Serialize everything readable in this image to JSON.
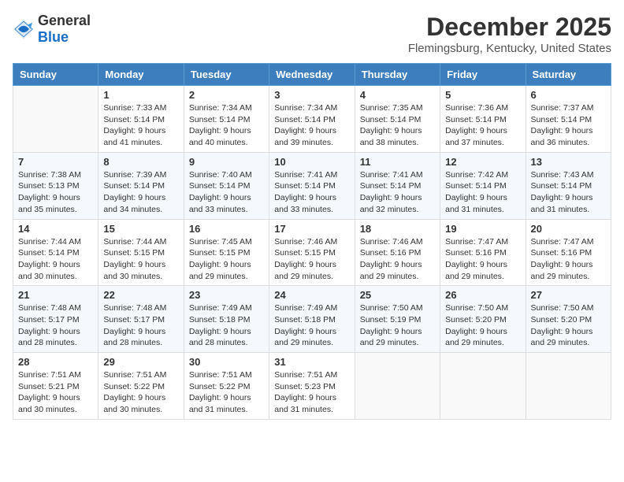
{
  "logo": {
    "general": "General",
    "blue": "Blue"
  },
  "title": "December 2025",
  "location": "Flemingsburg, Kentucky, United States",
  "headers": [
    "Sunday",
    "Monday",
    "Tuesday",
    "Wednesday",
    "Thursday",
    "Friday",
    "Saturday"
  ],
  "weeks": [
    [
      {
        "day": "",
        "sunrise": "",
        "sunset": "",
        "daylight": ""
      },
      {
        "day": "1",
        "sunrise": "Sunrise: 7:33 AM",
        "sunset": "Sunset: 5:14 PM",
        "daylight": "Daylight: 9 hours and 41 minutes."
      },
      {
        "day": "2",
        "sunrise": "Sunrise: 7:34 AM",
        "sunset": "Sunset: 5:14 PM",
        "daylight": "Daylight: 9 hours and 40 minutes."
      },
      {
        "day": "3",
        "sunrise": "Sunrise: 7:34 AM",
        "sunset": "Sunset: 5:14 PM",
        "daylight": "Daylight: 9 hours and 39 minutes."
      },
      {
        "day": "4",
        "sunrise": "Sunrise: 7:35 AM",
        "sunset": "Sunset: 5:14 PM",
        "daylight": "Daylight: 9 hours and 38 minutes."
      },
      {
        "day": "5",
        "sunrise": "Sunrise: 7:36 AM",
        "sunset": "Sunset: 5:14 PM",
        "daylight": "Daylight: 9 hours and 37 minutes."
      },
      {
        "day": "6",
        "sunrise": "Sunrise: 7:37 AM",
        "sunset": "Sunset: 5:14 PM",
        "daylight": "Daylight: 9 hours and 36 minutes."
      }
    ],
    [
      {
        "day": "7",
        "sunrise": "Sunrise: 7:38 AM",
        "sunset": "Sunset: 5:13 PM",
        "daylight": "Daylight: 9 hours and 35 minutes."
      },
      {
        "day": "8",
        "sunrise": "Sunrise: 7:39 AM",
        "sunset": "Sunset: 5:14 PM",
        "daylight": "Daylight: 9 hours and 34 minutes."
      },
      {
        "day": "9",
        "sunrise": "Sunrise: 7:40 AM",
        "sunset": "Sunset: 5:14 PM",
        "daylight": "Daylight: 9 hours and 33 minutes."
      },
      {
        "day": "10",
        "sunrise": "Sunrise: 7:41 AM",
        "sunset": "Sunset: 5:14 PM",
        "daylight": "Daylight: 9 hours and 33 minutes."
      },
      {
        "day": "11",
        "sunrise": "Sunrise: 7:41 AM",
        "sunset": "Sunset: 5:14 PM",
        "daylight": "Daylight: 9 hours and 32 minutes."
      },
      {
        "day": "12",
        "sunrise": "Sunrise: 7:42 AM",
        "sunset": "Sunset: 5:14 PM",
        "daylight": "Daylight: 9 hours and 31 minutes."
      },
      {
        "day": "13",
        "sunrise": "Sunrise: 7:43 AM",
        "sunset": "Sunset: 5:14 PM",
        "daylight": "Daylight: 9 hours and 31 minutes."
      }
    ],
    [
      {
        "day": "14",
        "sunrise": "Sunrise: 7:44 AM",
        "sunset": "Sunset: 5:14 PM",
        "daylight": "Daylight: 9 hours and 30 minutes."
      },
      {
        "day": "15",
        "sunrise": "Sunrise: 7:44 AM",
        "sunset": "Sunset: 5:15 PM",
        "daylight": "Daylight: 9 hours and 30 minutes."
      },
      {
        "day": "16",
        "sunrise": "Sunrise: 7:45 AM",
        "sunset": "Sunset: 5:15 PM",
        "daylight": "Daylight: 9 hours and 29 minutes."
      },
      {
        "day": "17",
        "sunrise": "Sunrise: 7:46 AM",
        "sunset": "Sunset: 5:15 PM",
        "daylight": "Daylight: 9 hours and 29 minutes."
      },
      {
        "day": "18",
        "sunrise": "Sunrise: 7:46 AM",
        "sunset": "Sunset: 5:16 PM",
        "daylight": "Daylight: 9 hours and 29 minutes."
      },
      {
        "day": "19",
        "sunrise": "Sunrise: 7:47 AM",
        "sunset": "Sunset: 5:16 PM",
        "daylight": "Daylight: 9 hours and 29 minutes."
      },
      {
        "day": "20",
        "sunrise": "Sunrise: 7:47 AM",
        "sunset": "Sunset: 5:16 PM",
        "daylight": "Daylight: 9 hours and 29 minutes."
      }
    ],
    [
      {
        "day": "21",
        "sunrise": "Sunrise: 7:48 AM",
        "sunset": "Sunset: 5:17 PM",
        "daylight": "Daylight: 9 hours and 28 minutes."
      },
      {
        "day": "22",
        "sunrise": "Sunrise: 7:48 AM",
        "sunset": "Sunset: 5:17 PM",
        "daylight": "Daylight: 9 hours and 28 minutes."
      },
      {
        "day": "23",
        "sunrise": "Sunrise: 7:49 AM",
        "sunset": "Sunset: 5:18 PM",
        "daylight": "Daylight: 9 hours and 28 minutes."
      },
      {
        "day": "24",
        "sunrise": "Sunrise: 7:49 AM",
        "sunset": "Sunset: 5:18 PM",
        "daylight": "Daylight: 9 hours and 29 minutes."
      },
      {
        "day": "25",
        "sunrise": "Sunrise: 7:50 AM",
        "sunset": "Sunset: 5:19 PM",
        "daylight": "Daylight: 9 hours and 29 minutes."
      },
      {
        "day": "26",
        "sunrise": "Sunrise: 7:50 AM",
        "sunset": "Sunset: 5:20 PM",
        "daylight": "Daylight: 9 hours and 29 minutes."
      },
      {
        "day": "27",
        "sunrise": "Sunrise: 7:50 AM",
        "sunset": "Sunset: 5:20 PM",
        "daylight": "Daylight: 9 hours and 29 minutes."
      }
    ],
    [
      {
        "day": "28",
        "sunrise": "Sunrise: 7:51 AM",
        "sunset": "Sunset: 5:21 PM",
        "daylight": "Daylight: 9 hours and 30 minutes."
      },
      {
        "day": "29",
        "sunrise": "Sunrise: 7:51 AM",
        "sunset": "Sunset: 5:22 PM",
        "daylight": "Daylight: 9 hours and 30 minutes."
      },
      {
        "day": "30",
        "sunrise": "Sunrise: 7:51 AM",
        "sunset": "Sunset: 5:22 PM",
        "daylight": "Daylight: 9 hours and 31 minutes."
      },
      {
        "day": "31",
        "sunrise": "Sunrise: 7:51 AM",
        "sunset": "Sunset: 5:23 PM",
        "daylight": "Daylight: 9 hours and 31 minutes."
      },
      {
        "day": "",
        "sunrise": "",
        "sunset": "",
        "daylight": ""
      },
      {
        "day": "",
        "sunrise": "",
        "sunset": "",
        "daylight": ""
      },
      {
        "day": "",
        "sunrise": "",
        "sunset": "",
        "daylight": ""
      }
    ]
  ]
}
